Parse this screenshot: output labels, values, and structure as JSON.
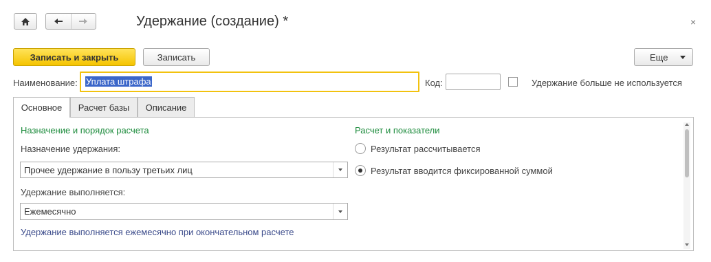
{
  "window": {
    "title": "Удержание (создание) *",
    "close_glyph": "×"
  },
  "toolbar": {
    "save_close_label": "Записать и закрыть",
    "save_label": "Записать",
    "more_label": "Еще"
  },
  "fields": {
    "name_label": "Наименование:",
    "name_value": "Уплата штрафа",
    "code_label": "Код:",
    "code_value": "",
    "unused_label": "Удержание больше не используется",
    "unused_checked": false
  },
  "tabs": [
    {
      "label": "Основное",
      "active": true
    },
    {
      "label": "Расчет базы",
      "active": false
    },
    {
      "label": "Описание",
      "active": false
    }
  ],
  "main": {
    "left_section_title": "Назначение и порядок расчета",
    "purpose_label": "Назначение удержания:",
    "purpose_value": "Прочее удержание в пользу третьих лиц",
    "period_label": "Удержание выполняется:",
    "period_value": "Ежемесячно",
    "info_text": "Удержание выполняется ежемесячно при окончательном расчете",
    "right_section_title": "Расчет и показатели",
    "radio_options": [
      {
        "label": "Результат рассчитывается",
        "selected": false
      },
      {
        "label": "Результат вводится фиксированной суммой",
        "selected": true
      }
    ]
  },
  "colors": {
    "accent_yellow": "#f5c400",
    "section_green": "#1a8a3a",
    "info_blue": "#3a4a8a",
    "selection_blue": "#3b66c9"
  }
}
